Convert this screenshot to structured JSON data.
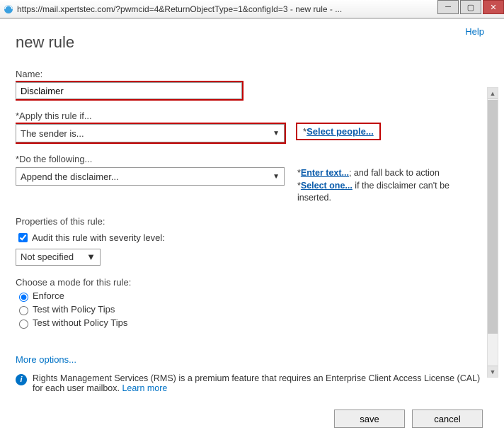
{
  "titlebar": {
    "url": "https://mail.xpertstec.com/?pwmcid=4&ReturnObjectType=1&configId=3 - new rule - ..."
  },
  "help_label": "Help",
  "page_title": "new rule",
  "name": {
    "label": "Name:",
    "value": "Disclaimer"
  },
  "apply_if": {
    "label": "*Apply this rule if...",
    "selected": "The sender is...",
    "side_link": "Select people..."
  },
  "do_following": {
    "label": "*Do the following...",
    "selected": "Append the disclaimer...",
    "side_text_prefix": "*",
    "enter_text_link": "Enter text...",
    "side_text_mid": "; and fall back to action *",
    "select_one_link": "Select one...",
    "side_text_suffix": " if the disclaimer can't be inserted."
  },
  "properties_label": "Properties of this rule:",
  "audit": {
    "label": "Audit this rule with severity level:",
    "checked": true,
    "severity": "Not specified"
  },
  "mode": {
    "label": "Choose a mode for this rule:",
    "options": {
      "enforce": "Enforce",
      "test_tips": "Test with Policy Tips",
      "test_notips": "Test without Policy Tips"
    },
    "selected": "enforce"
  },
  "more_options": "More options...",
  "rms_info": "Rights Management Services (RMS) is a premium feature that requires an Enterprise Client Access License (CAL) for each user mailbox. ",
  "learn_more": "Learn more",
  "buttons": {
    "save": "save",
    "cancel": "cancel"
  }
}
